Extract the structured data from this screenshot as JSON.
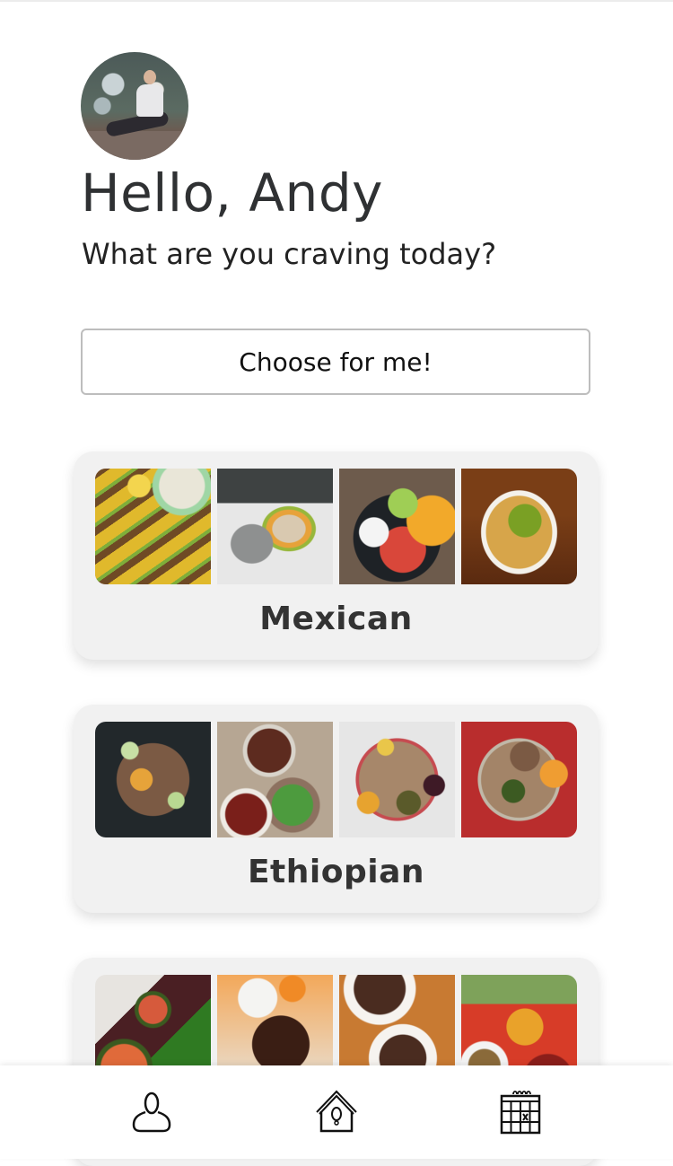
{
  "header": {
    "avatar_alt": "Andy profile photo",
    "greeting": "Hello, Andy",
    "subtitle": "What are you craving today?"
  },
  "actions": {
    "choose_label": "Choose for me!"
  },
  "cuisines": [
    {
      "label": "Mexican",
      "images": [
        "tacos",
        "burrito",
        "salsa-bowl",
        "nachos"
      ]
    },
    {
      "label": "Ethiopian",
      "images": [
        "injera-plate",
        "tibs-salad",
        "beyaynetu",
        "combo-platter"
      ]
    },
    {
      "label": "",
      "images": [
        "banana-leaf-dish",
        "glazed-pork",
        "beef-bowl",
        "rice-skewers"
      ]
    }
  ],
  "bottom_nav": {
    "items": [
      {
        "icon": "user-icon",
        "label": "Profile"
      },
      {
        "icon": "birdhouse-icon",
        "label": "Home"
      },
      {
        "icon": "calendar-icon",
        "label": "Calendar"
      }
    ]
  }
}
